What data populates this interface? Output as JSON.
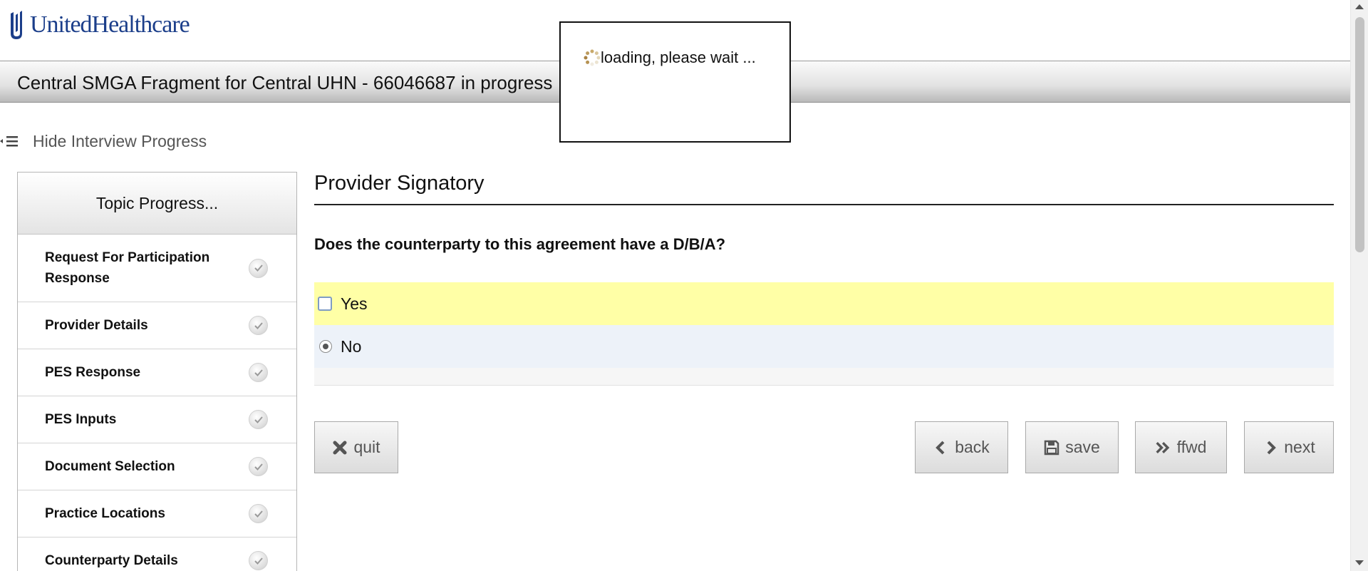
{
  "brand": {
    "name": "UnitedHealthcare",
    "color": "#1b3e8a"
  },
  "header": {
    "title": "Central SMGA Fragment for Central UHN - 66046687 in progress"
  },
  "progress_toggle": {
    "label": "Hide Interview Progress",
    "icon": "menu-collapse-icon"
  },
  "sidebar": {
    "heading": "Topic Progress...",
    "items": [
      {
        "label": "Request For Participation Response",
        "status": "complete"
      },
      {
        "label": "Provider Details",
        "status": "complete"
      },
      {
        "label": "PES Response",
        "status": "complete"
      },
      {
        "label": "PES Inputs",
        "status": "complete"
      },
      {
        "label": "Document Selection",
        "status": "complete"
      },
      {
        "label": "Practice Locations",
        "status": "complete"
      },
      {
        "label": "Counterparty Details",
        "status": "complete"
      }
    ]
  },
  "main": {
    "section_title": "Provider Signatory",
    "question": "Does the counterparty to this agreement have a D/B/A?",
    "options": [
      {
        "label": "Yes",
        "selected": false,
        "highlight": "#ffffa6"
      },
      {
        "label": "No",
        "selected": true,
        "highlight": "#edf2f9"
      }
    ]
  },
  "buttons": {
    "quit": "quit",
    "back": "back",
    "save": "save",
    "ffwd": "ffwd",
    "next": "next"
  },
  "loading": {
    "text": "loading, please wait ..."
  }
}
